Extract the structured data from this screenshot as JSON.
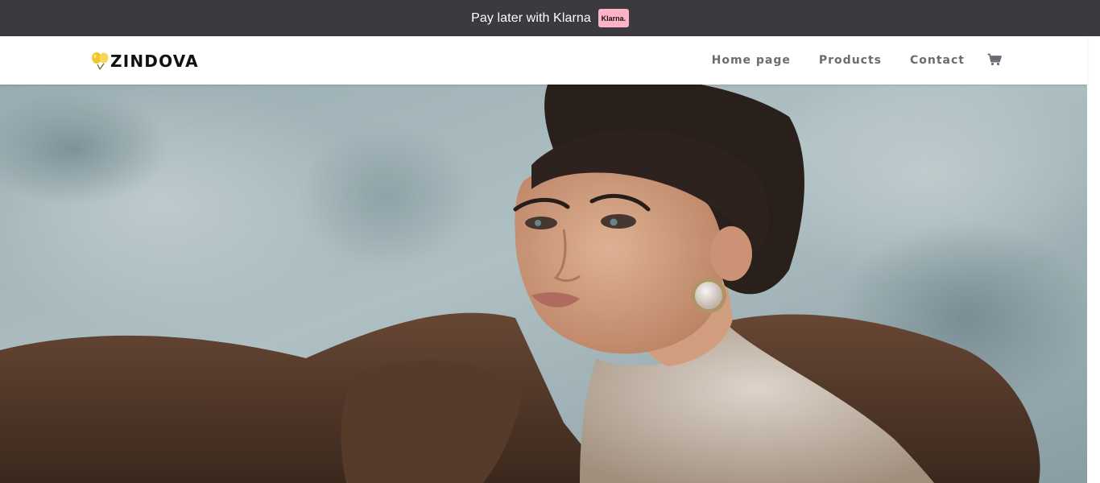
{
  "announcement": {
    "text": "Pay later with Klarna",
    "badge_label": "Klarna."
  },
  "header": {
    "logo_text": "ZINDOVA",
    "logo_icon": "balloons-icon",
    "nav": [
      {
        "label": "Home page"
      },
      {
        "label": "Products"
      },
      {
        "label": "Contact"
      }
    ],
    "cart_icon": "cart-icon"
  },
  "hero": {
    "image_subject": "model in brown fur stole and sequin top against blue-grey concrete wall"
  },
  "colors": {
    "topbar_bg": "#3a3a3f",
    "klarna_pink": "#ffb3c7",
    "nav_text": "#6b6b72",
    "logo_balloon": "#f3c52a"
  }
}
